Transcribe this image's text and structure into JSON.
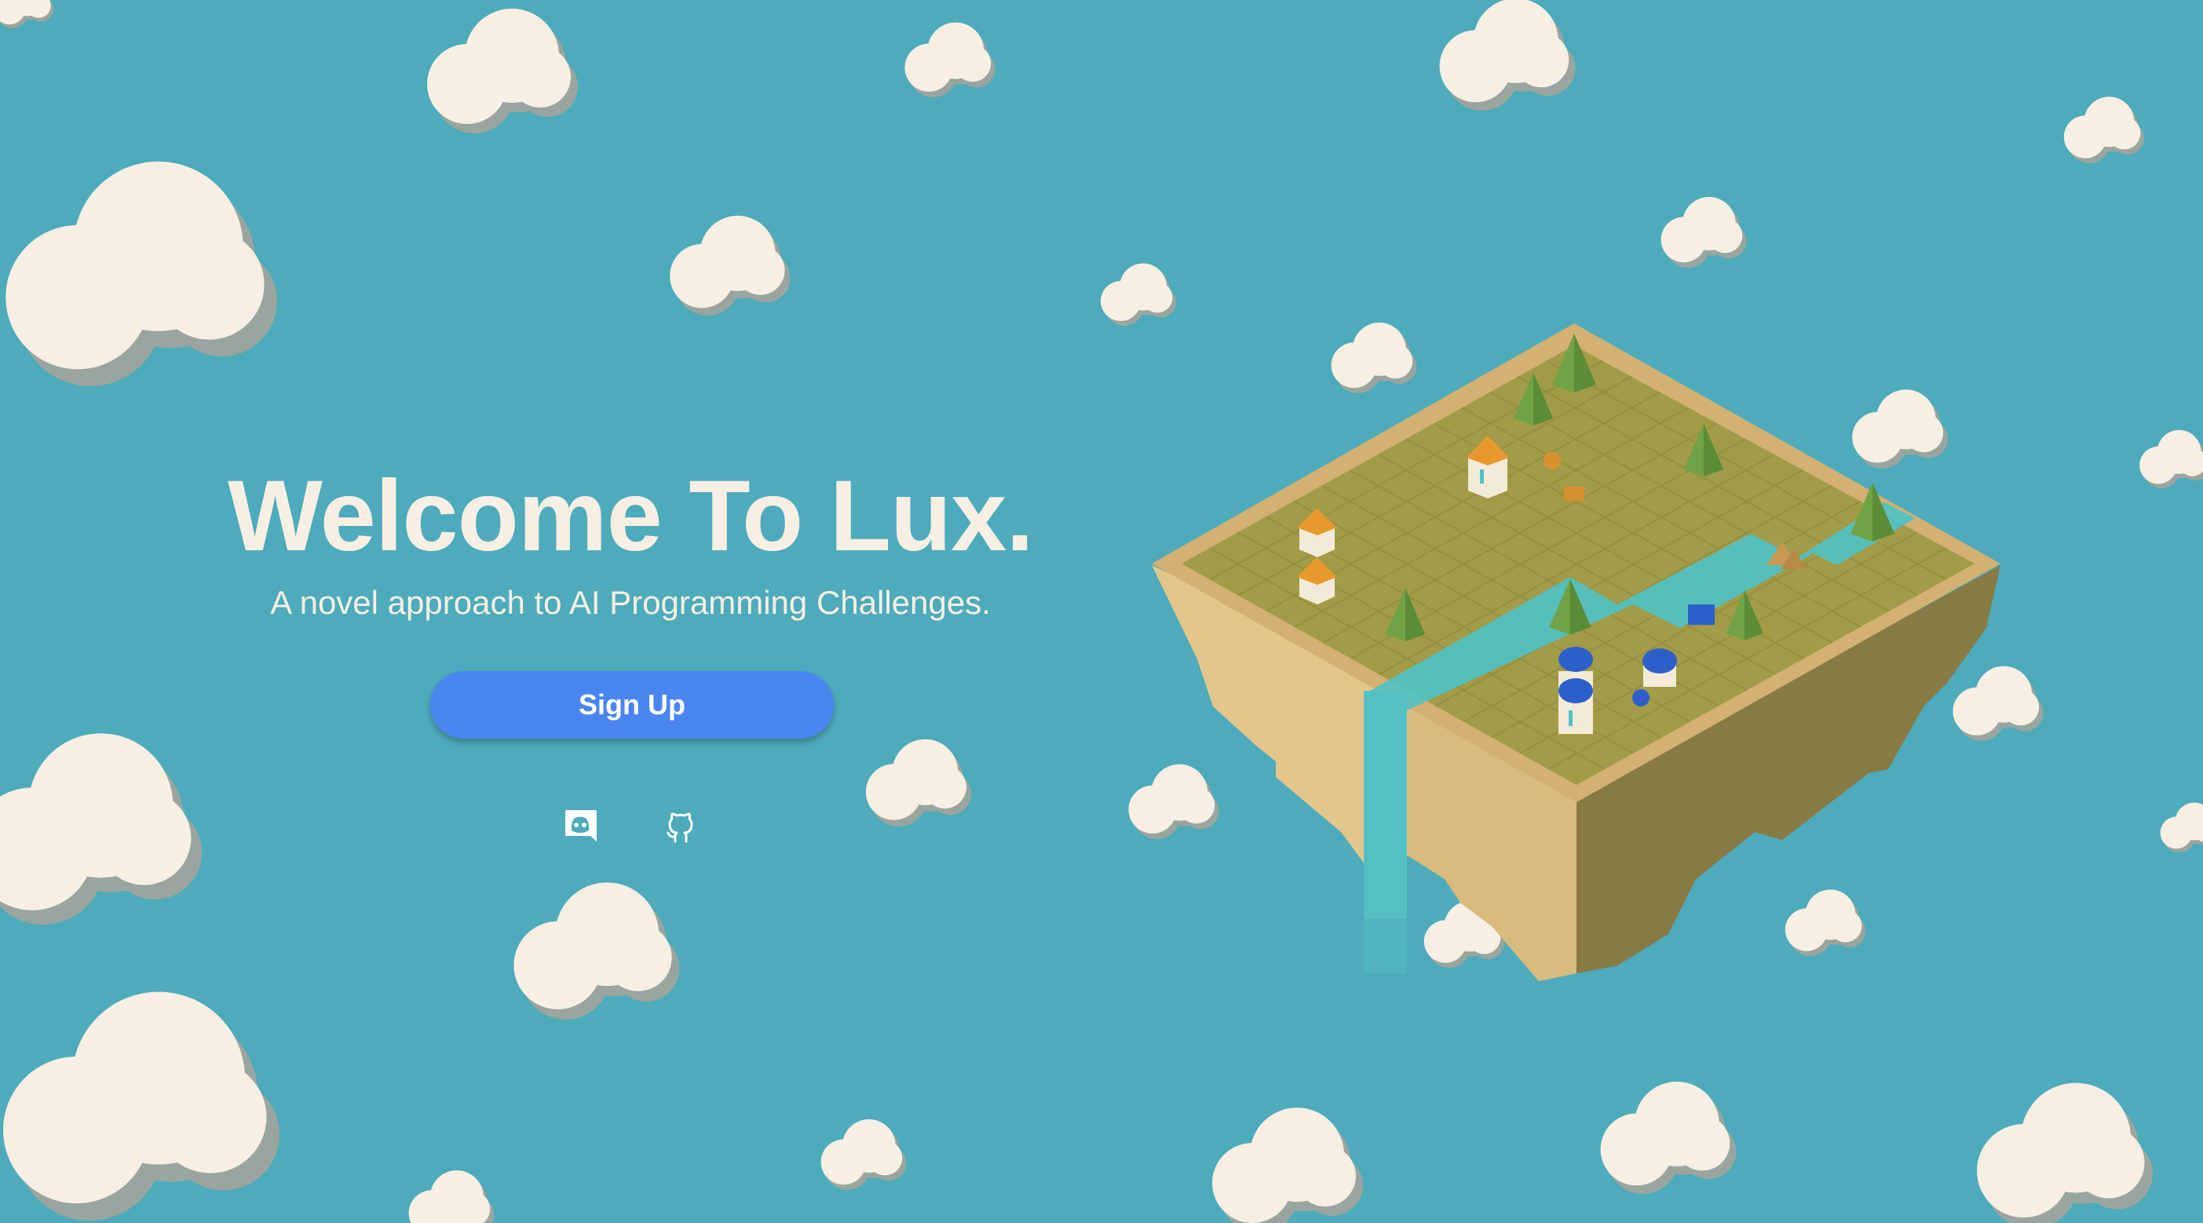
{
  "hero": {
    "title": "Welcome To Lux.",
    "subtitle": "A novel approach to AI Programming Challenges.",
    "cta_label": "Sign Up"
  },
  "social_links": [
    {
      "name": "discord",
      "icon": "discord-icon"
    },
    {
      "name": "github",
      "icon": "github-icon"
    }
  ],
  "colors": {
    "sky": "#4dabbb",
    "cloud": "#f7efe3",
    "cloud_shadow": "#9aa59f",
    "text": "#f7efe3",
    "button": "#4a86f0",
    "button_text": "#ffffff",
    "grass": "#a29b48",
    "grass_dark": "#8f8940",
    "sand_light": "#e3c68b",
    "sand_mid": "#d3b172",
    "cliff_dark": "#877a45",
    "water": "#4fc3c7",
    "tree": "#6fa346",
    "house_roof_orange": "#e8992e",
    "house_roof_blue": "#2c5fc9"
  }
}
